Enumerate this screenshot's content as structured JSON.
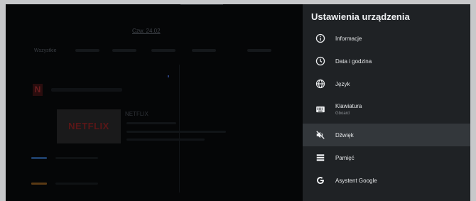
{
  "background_app": {
    "date_tab": "Czw. 24.02",
    "category": "Wszystkie",
    "provider_logo": "N",
    "tile_logo": "NETFLIX",
    "tile_title": "NETFLIX"
  },
  "settings": {
    "title": "Ustawienia urządzenia",
    "items": [
      {
        "label": "Informacje",
        "icon": "info-icon"
      },
      {
        "label": "Data i godzina",
        "icon": "clock-icon"
      },
      {
        "label": "Język",
        "icon": "globe-icon"
      },
      {
        "label": "Klawiatura",
        "sublabel": "Gboard",
        "icon": "keyboard-icon"
      },
      {
        "label": "Dźwięk",
        "icon": "sound-icon",
        "selected": true
      },
      {
        "label": "Pamięć",
        "icon": "storage-icon"
      },
      {
        "label": "Asystent Google",
        "icon": "google-icon"
      }
    ]
  },
  "colors": {
    "panel_bg": "#1f2225",
    "selected_bg": "#33373b",
    "text": "#e4e6e8"
  }
}
